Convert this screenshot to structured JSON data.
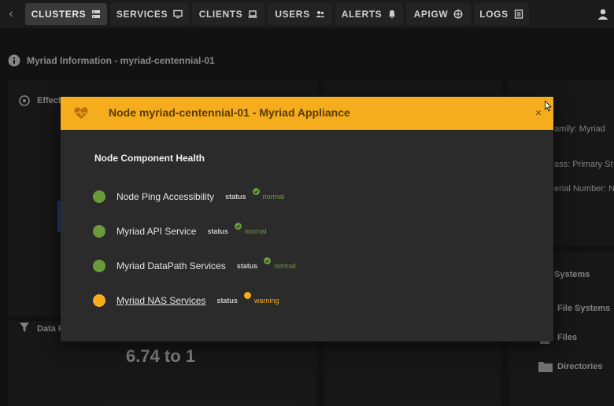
{
  "nav": {
    "back_icon": "chevron-left-icon",
    "tabs": [
      {
        "label": "CLUSTERS",
        "icon": "server-icon",
        "active": true
      },
      {
        "label": "SERVICES",
        "icon": "monitor-icon",
        "active": false
      },
      {
        "label": "CLIENTS",
        "icon": "laptop-icon",
        "active": false
      },
      {
        "label": "USERS",
        "icon": "users-icon",
        "active": false
      },
      {
        "label": "ALERTS",
        "icon": "bell-icon",
        "active": false
      },
      {
        "label": "APIGW",
        "icon": "globe-icon",
        "active": false
      },
      {
        "label": "LOGS",
        "icon": "logs-icon",
        "active": false
      }
    ],
    "user_icon": "user-icon"
  },
  "page": {
    "title": "Myriad Information - myriad-centennial-01"
  },
  "background": {
    "effective_heading": "Effect",
    "data_heading": "Data F",
    "ratio": "6.74 to 1",
    "family": "amily: Myriad",
    "class": "ass: Primary St",
    "serial": "erial Number: NA",
    "systems": "Systems",
    "file_systems": "File Systems",
    "files": "Files",
    "directories": "Directories"
  },
  "modal": {
    "title": "Node myriad-centennial-01 - Myriad Appliance",
    "close_label": "×",
    "section_heading": "Node Component Health",
    "status_label": "status",
    "components": [
      {
        "name": "Node Ping Accessibility",
        "status": "normal",
        "link": false
      },
      {
        "name": "Myriad API Service",
        "status": "normal",
        "link": false
      },
      {
        "name": "Myriad DataPath Services",
        "status": "normal",
        "link": false
      },
      {
        "name": "Myriad NAS Services",
        "status": "warning",
        "link": true
      }
    ]
  },
  "colors": {
    "accent": "#f5ad1d",
    "normal": "#6b9a3a",
    "normal_text": "#6f9a35",
    "warning": "#f5ad1d"
  }
}
